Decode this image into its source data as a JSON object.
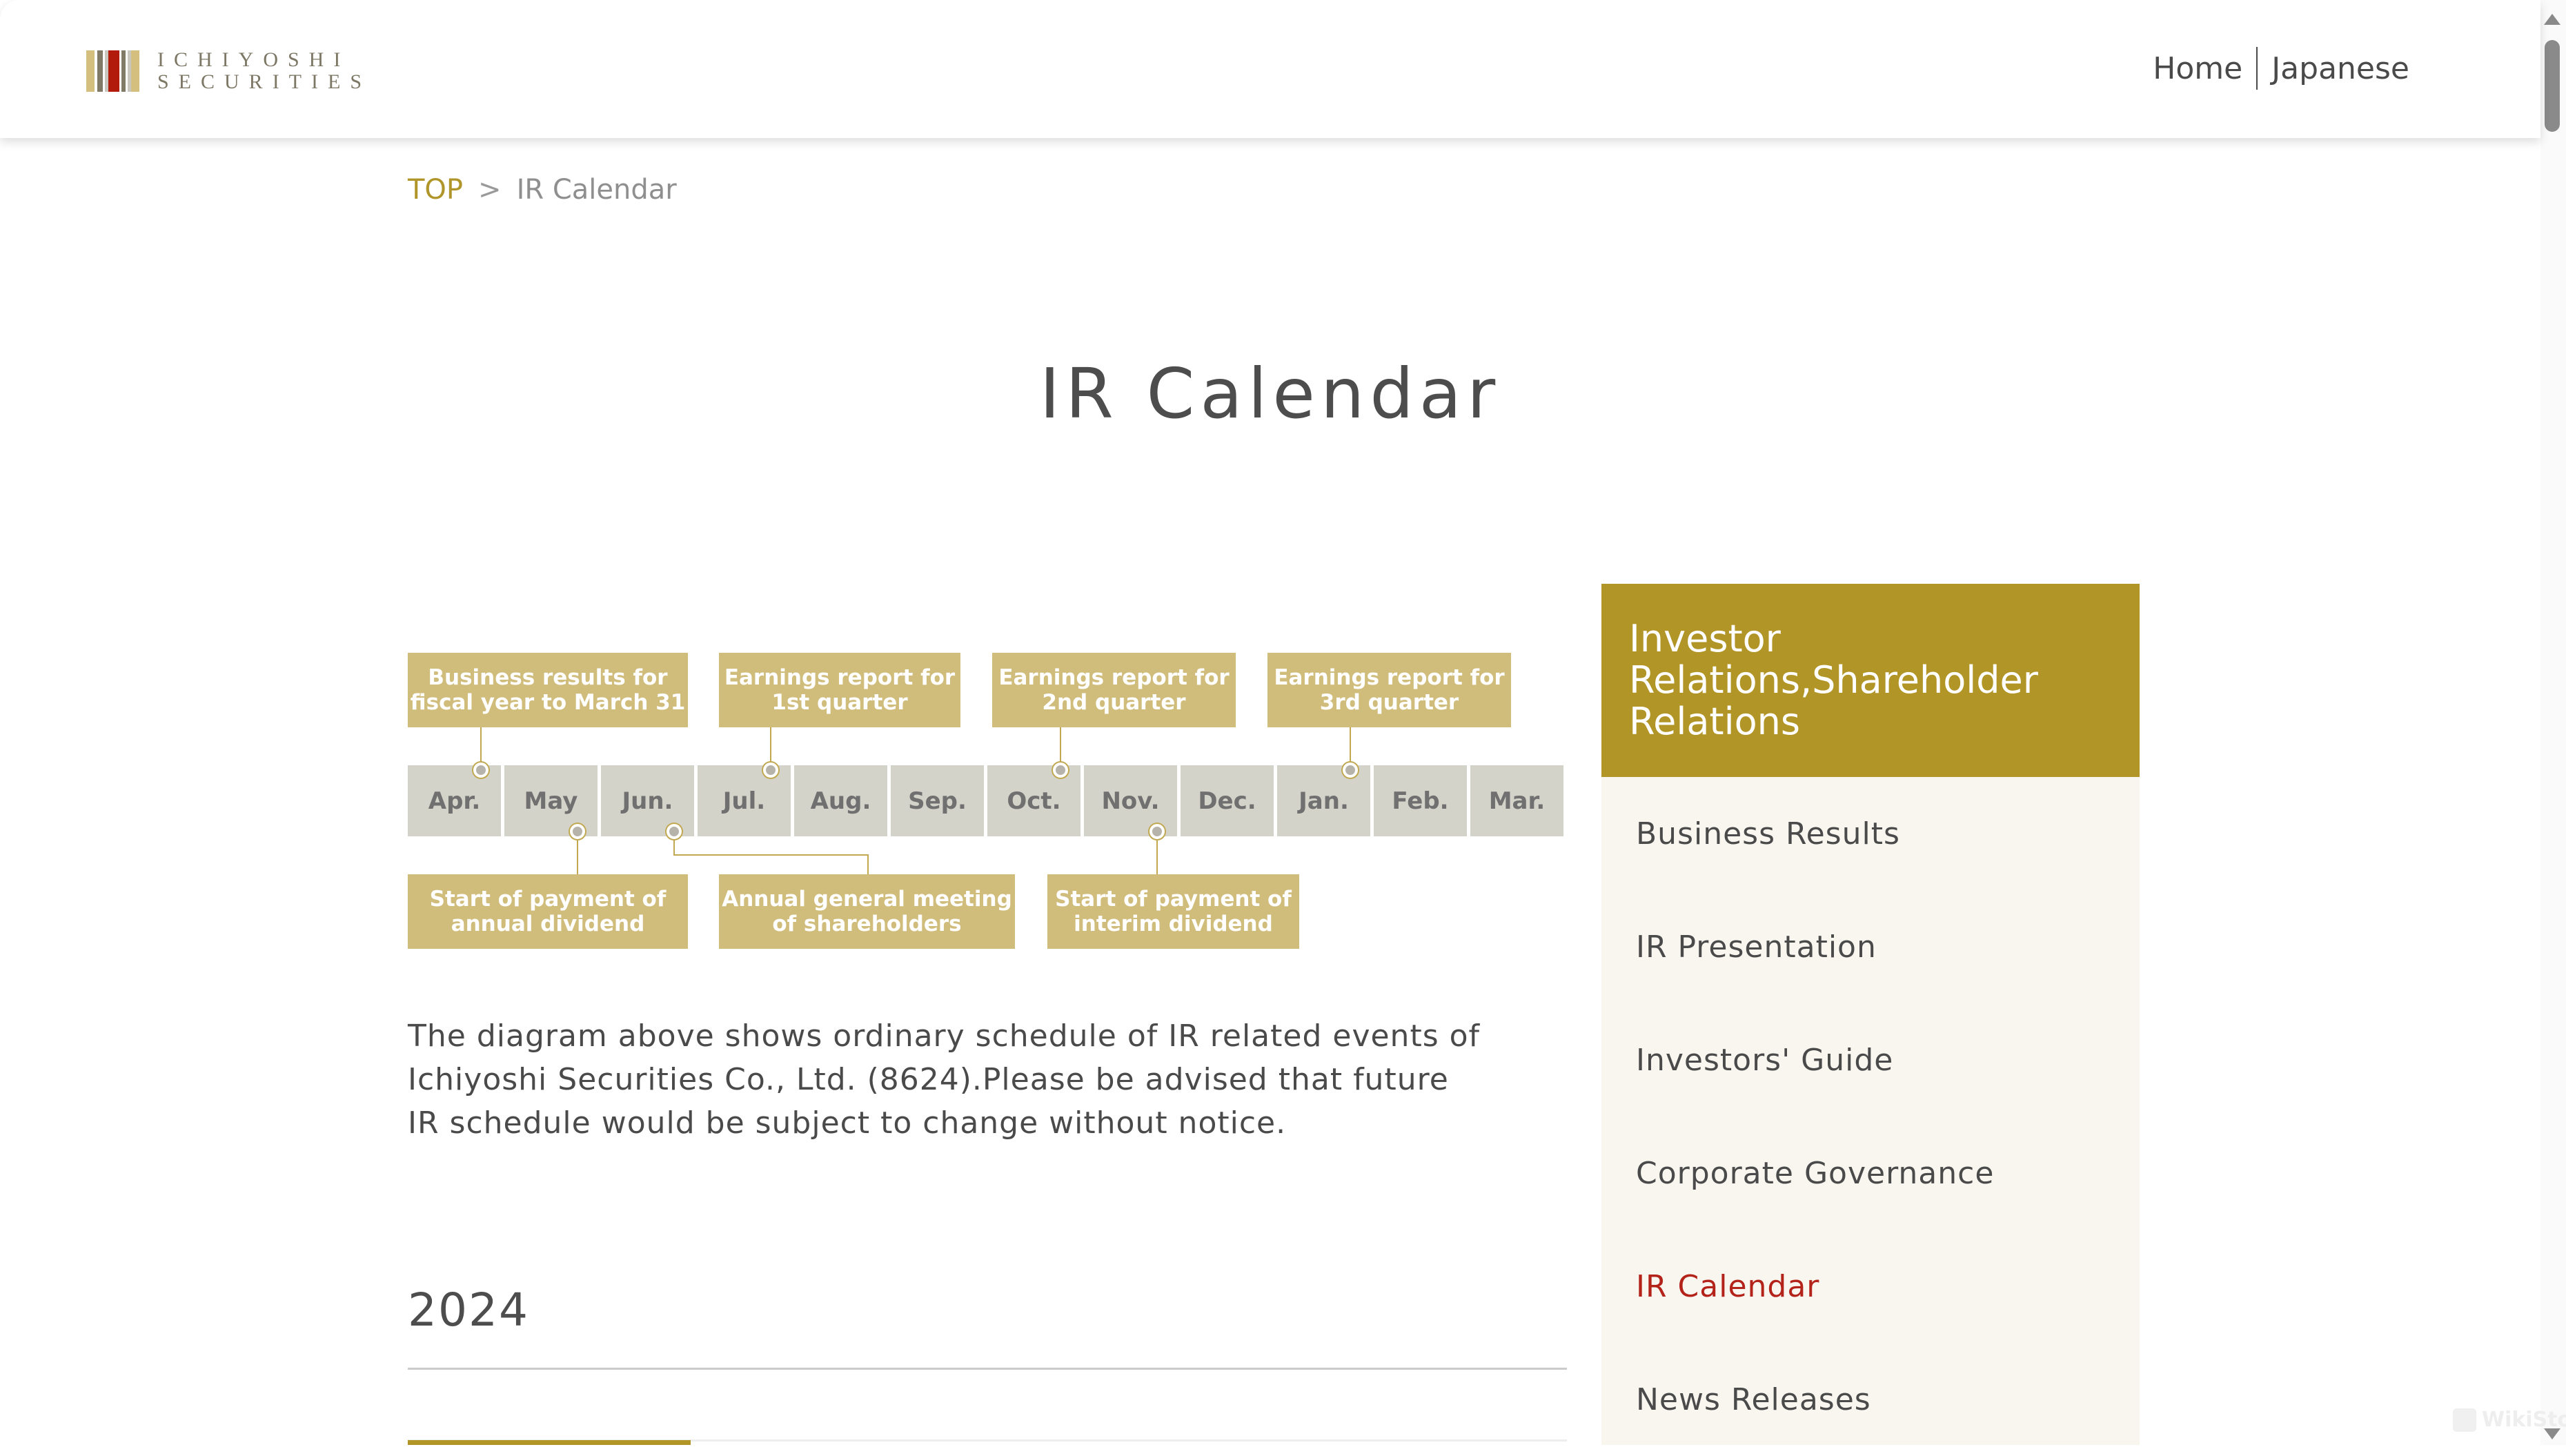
{
  "header": {
    "logo": {
      "line1": "ICHIYOSHI",
      "line2": "SECURITIES",
      "stripe_colors": [
        "#d4bf7f",
        "#ffffff",
        "#807a66",
        "#ffffff",
        "#c9c7bd",
        "#b21a0c",
        "#ffffff",
        "#807a66",
        "#ffffff",
        "#c9c7bd",
        "#d4bf7f"
      ]
    },
    "nav": [
      {
        "label": "Home"
      },
      {
        "label": "Japanese"
      }
    ]
  },
  "breadcrumb": {
    "home": "TOP",
    "separator": ">",
    "current": "IR Calendar"
  },
  "page_title": "IR Calendar",
  "diagram": {
    "months": [
      "Apr.",
      "May",
      "Jun.",
      "Jul.",
      "Aug.",
      "Sep.",
      "Oct.",
      "Nov.",
      "Dec.",
      "Jan.",
      "Feb.",
      "Mar."
    ],
    "events_above": [
      {
        "label": "Business results for\nfiscal year to March 31",
        "month_index": 0
      },
      {
        "label": "Earnings report for\n1st quarter",
        "month_index": 3
      },
      {
        "label": "Earnings report for\n2nd quarter",
        "month_index": 6
      },
      {
        "label": "Earnings report for\n3rd quarter",
        "month_index": 9
      }
    ],
    "events_below": [
      {
        "label": "Start of payment of\nannual dividend",
        "month_index": 1
      },
      {
        "label": "Annual general meeting\nof shareholders",
        "month_index": 2
      },
      {
        "label": "Start of payment of\ninterim dividend",
        "month_index": 7
      }
    ],
    "colors": {
      "box": "#d0bd7c",
      "cell": "#d4d3ca",
      "connector": "#c1a851"
    }
  },
  "description": "The diagram above shows ordinary schedule of IR related events of Ichiyoshi Securities Co., Ltd. (8624).Please be advised that future IR schedule would be subject to change without notice.",
  "year_section": {
    "heading": "2024"
  },
  "sidebar": {
    "heading": "Investor Relations,Shareholder Relations",
    "items": [
      {
        "label": "Business Results",
        "active": false
      },
      {
        "label": "IR Presentation",
        "active": false
      },
      {
        "label": "Investors' Guide",
        "active": false
      },
      {
        "label": "Corporate Governance",
        "active": false
      },
      {
        "label": "IR Calendar",
        "active": true
      },
      {
        "label": "News Releases",
        "active": false
      }
    ]
  },
  "watermark": "WikiStock",
  "colors": {
    "brand_gold": "#b19526",
    "active_link": "#b3231a",
    "text": "#4a4a4a",
    "sidebar_bg": "#f9f6f0"
  }
}
